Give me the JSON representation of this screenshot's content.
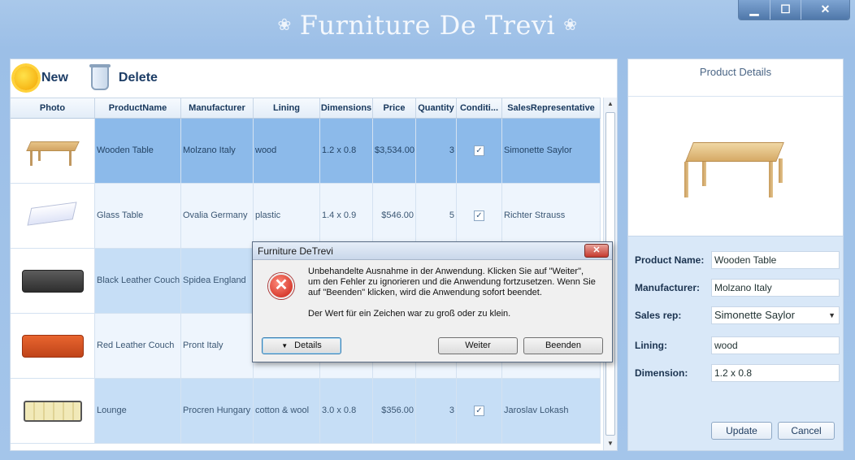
{
  "window": {
    "title": "Furniture De Trevi",
    "controls": [
      "minimize",
      "maximize",
      "close"
    ],
    "minimize_glyph": "▁",
    "maximize_glyph": "☐",
    "close_glyph": "✕",
    "ornament": "❀"
  },
  "toolbar": {
    "new_label": "New",
    "delete_label": "Delete"
  },
  "grid": {
    "columns": [
      "Photo",
      "ProductName",
      "Manufacturer",
      "Lining",
      "Dimensions",
      "Price",
      "Quantity",
      "Conditi...",
      "SalesRepresentative"
    ],
    "rows": [
      {
        "photo": "wooden-table",
        "name": "Wooden Table",
        "manufacturer": "Molzano Italy",
        "lining": "wood",
        "dimensions": "1.2 x 0.8",
        "price": "$3,534.00",
        "quantity": "3",
        "condition": true,
        "sales": "Simonette Saylor"
      },
      {
        "photo": "glass-table",
        "name": "Glass Table",
        "manufacturer": "Ovalia Germany",
        "lining": "plastic",
        "dimensions": "1.4 x 0.9",
        "price": "$546.00",
        "quantity": "5",
        "condition": true,
        "sales": "Richter Strauss"
      },
      {
        "photo": "black-couch",
        "name": "Black Leather Couch",
        "manufacturer": "Spidea England",
        "lining": "",
        "dimensions": "",
        "price": "",
        "quantity": "",
        "condition": false,
        "sales": ""
      },
      {
        "photo": "red-couch",
        "name": "Red Leather Couch",
        "manufacturer": "Pront Italy",
        "lining": "",
        "dimensions": "",
        "price": "",
        "quantity": "",
        "condition": false,
        "sales": ""
      },
      {
        "photo": "lounge",
        "name": "Lounge",
        "manufacturer": "Procren Hungary",
        "lining": "cotton & wool",
        "dimensions": "3.0 x 0.8",
        "price": "$356.00",
        "quantity": "3",
        "condition": true,
        "sales": "Jaroslav Lokash"
      }
    ],
    "check_glyph": "✓",
    "scroll_up": "▲",
    "scroll_down": "▼"
  },
  "details": {
    "title": "Product Details",
    "product_name_label": "Product Name:",
    "product_name_value": "Wooden Table",
    "manufacturer_label": "Manufacturer:",
    "manufacturer_value": "Molzano Italy",
    "sales_rep_label": "Sales rep:",
    "sales_rep_value": "Simonette Saylor",
    "lining_label": "Lining:",
    "lining_value": "wood",
    "dimension_label": "Dimension:",
    "dimension_value": "1.2 x 0.8",
    "update_label": "Update",
    "cancel_label": "Cancel",
    "combo_arrow": "▼"
  },
  "dialog": {
    "title": "Furniture DeTrevi",
    "close_glyph": "✕",
    "error_glyph": "✕",
    "message_line1": "Unbehandelte Ausnahme in der Anwendung. Klicken Sie auf \"Weiter\",",
    "message_line2": "um den Fehler zu ignorieren und die Anwendung fortzusetzen. Wenn Sie",
    "message_line3": "auf \"Beenden\" klicken, wird die Anwendung sofort beendet.",
    "detail_message": "Der Wert für ein Zeichen war zu groß oder zu klein.",
    "details_arrow": "▼",
    "details_label": "Details",
    "continue_label": "Weiter",
    "quit_label": "Beenden"
  }
}
